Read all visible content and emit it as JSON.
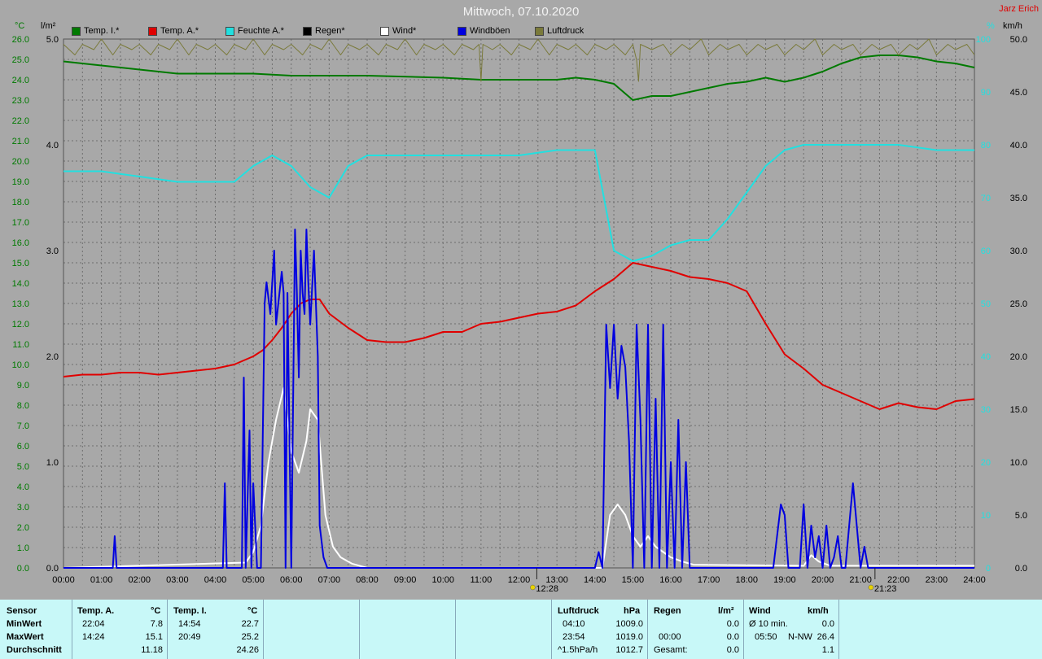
{
  "header": {
    "title": "Mittwoch, 07.10.2020",
    "author": "Jarz Erich",
    "unit_temp": "°C",
    "unit_rain": "l/m²",
    "unit_hum": "%",
    "unit_wind": "km/h"
  },
  "legend": [
    {
      "label": "Temp. I.*",
      "color": "#007a00"
    },
    {
      "label": "Temp. A.*",
      "color": "#e00000"
    },
    {
      "label": "Feuchte A.*",
      "color": "#22e0e0"
    },
    {
      "label": "Regen*",
      "color": "#000000"
    },
    {
      "label": "Wind*",
      "color": "#ffffff"
    },
    {
      "label": "Windböen",
      "color": "#0000e0"
    },
    {
      "label": "Luftdruck",
      "color": "#7a7a3a"
    }
  ],
  "chart_data": {
    "type": "line",
    "x_unit": "hours",
    "xlim": [
      0,
      24
    ],
    "x_ticks": [
      "00:00",
      "01:00",
      "02:00",
      "03:00",
      "04:00",
      "05:00",
      "06:00",
      "07:00",
      "08:00",
      "09:00",
      "10:00",
      "11:00",
      "12:00",
      "13:00",
      "14:00",
      "15:00",
      "16:00",
      "17:00",
      "18:00",
      "19:00",
      "20:00",
      "21:00",
      "22:00",
      "23:00",
      "24:00"
    ],
    "axes": {
      "temp": {
        "range": [
          0,
          26
        ],
        "ticks": [
          "0.0",
          "1.0",
          "2.0",
          "3.0",
          "4.0",
          "5.0",
          "6.0",
          "7.0",
          "8.0",
          "9.0",
          "10.0",
          "11.0",
          "12.0",
          "13.0",
          "14.0",
          "15.0",
          "16.0",
          "17.0",
          "18.0",
          "19.0",
          "20.0",
          "21.0",
          "22.0",
          "23.0",
          "24.0",
          "25.0",
          "26.0"
        ],
        "color": "#007a00"
      },
      "rain": {
        "range": [
          0,
          5
        ],
        "ticks": [
          "0.0",
          "1.0",
          "2.0",
          "3.0",
          "4.0",
          "5.0"
        ],
        "color": "#000000"
      },
      "humidity": {
        "range": [
          0,
          100
        ],
        "ticks": [
          "0",
          "10",
          "20",
          "30",
          "40",
          "50",
          "60",
          "70",
          "80",
          "90",
          "100"
        ],
        "color": "#22e0e0"
      },
      "wind": {
        "range": [
          0,
          50
        ],
        "ticks": [
          "0.0",
          "5.0",
          "10.0",
          "15.0",
          "20.0",
          "25.0",
          "30.0",
          "35.0",
          "40.0",
          "45.0",
          "50.0"
        ],
        "color": "#000000"
      }
    },
    "markers": [
      {
        "label": "12:28",
        "x": 12.47
      },
      {
        "label": "21:23",
        "x": 21.38
      }
    ],
    "series": [
      {
        "name": "Temp. I.*",
        "axis": "temp",
        "color": "#007a00",
        "x": [
          0,
          0.5,
          1,
          2,
          3,
          4,
          5,
          6,
          6.5,
          7,
          8,
          10,
          11,
          12,
          13,
          13.5,
          14,
          14.5,
          15,
          15.5,
          16,
          17,
          17.5,
          18,
          18.5,
          19,
          19.5,
          20,
          20.5,
          21,
          21.5,
          22,
          22.5,
          23,
          23.5,
          24
        ],
        "y": [
          24.9,
          24.8,
          24.7,
          24.5,
          24.3,
          24.3,
          24.3,
          24.2,
          24.2,
          24.2,
          24.2,
          24.1,
          24.0,
          24.0,
          24.0,
          24.1,
          24.0,
          23.8,
          23.0,
          23.2,
          23.2,
          23.6,
          23.8,
          23.9,
          24.1,
          23.9,
          24.1,
          24.4,
          24.8,
          25.1,
          25.2,
          25.2,
          25.1,
          24.9,
          24.8,
          24.6
        ]
      },
      {
        "name": "Temp. A.*",
        "axis": "temp",
        "color": "#e00000",
        "x": [
          0,
          0.5,
          1,
          1.5,
          2,
          2.5,
          3,
          3.5,
          4,
          4.5,
          5,
          5.25,
          5.5,
          5.75,
          6,
          6.25,
          6.5,
          6.75,
          7,
          7.5,
          8,
          8.5,
          9,
          9.5,
          10,
          10.5,
          11,
          11.5,
          12,
          12.5,
          13,
          13.5,
          14,
          14.5,
          15,
          15.5,
          16,
          16.5,
          17,
          17.5,
          18,
          18.5,
          19,
          19.5,
          20,
          20.5,
          21,
          21.5,
          22,
          22.5,
          23,
          23.5,
          24
        ],
        "y": [
          9.4,
          9.5,
          9.5,
          9.6,
          9.6,
          9.5,
          9.6,
          9.7,
          9.8,
          10.0,
          10.4,
          10.7,
          11.2,
          11.8,
          12.5,
          13.0,
          13.2,
          13.2,
          12.5,
          11.8,
          11.2,
          11.1,
          11.1,
          11.3,
          11.6,
          11.6,
          12.0,
          12.1,
          12.3,
          12.5,
          12.6,
          12.9,
          13.6,
          14.2,
          15.0,
          14.8,
          14.6,
          14.3,
          14.2,
          14.0,
          13.6,
          12.0,
          10.5,
          9.8,
          9.0,
          8.6,
          8.2,
          7.8,
          8.1,
          7.9,
          7.8,
          8.2,
          8.3
        ]
      },
      {
        "name": "Feuchte A.*",
        "axis": "humidity",
        "color": "#22e0e0",
        "x": [
          0,
          1,
          2,
          3,
          4,
          4.5,
          5,
          5.5,
          6,
          6.5,
          7,
          7.5,
          8,
          9,
          10,
          11,
          12,
          13,
          14,
          14.5,
          15,
          15.5,
          16,
          16.5,
          17,
          17.5,
          18,
          18.5,
          19,
          19.5,
          20,
          21,
          22,
          23,
          24
        ],
        "y": [
          75,
          75,
          74,
          73,
          73,
          73,
          76,
          78,
          76,
          72,
          70,
          76,
          78,
          78,
          78,
          78,
          78,
          79,
          79,
          60,
          58,
          59,
          61,
          62,
          62,
          66,
          71,
          76,
          79,
          80,
          80,
          80,
          80,
          79,
          79
        ]
      },
      {
        "name": "Wind*",
        "axis": "wind",
        "color": "#ffffff",
        "x": [
          0,
          4.8,
          5.0,
          5.2,
          5.4,
          5.6,
          5.8,
          6.0,
          6.2,
          6.4,
          6.5,
          6.7,
          6.9,
          7.1,
          7.3,
          7.6,
          8.0,
          14.2,
          14.4,
          14.6,
          14.8,
          15.0,
          15.2,
          15.4,
          15.6,
          15.8,
          16.0,
          16.3,
          16.6,
          19.5,
          19.7,
          19.9,
          20.2,
          24
        ],
        "y": [
          0,
          0.5,
          1.5,
          4.0,
          10.0,
          14.0,
          17.0,
          11.0,
          9.0,
          12.0,
          15.0,
          14.0,
          5.0,
          2.0,
          1.0,
          0.4,
          0,
          0,
          5.0,
          6.0,
          5.0,
          3.0,
          2.0,
          3.0,
          2.0,
          1.5,
          1.0,
          0.6,
          0.3,
          0.2,
          1.2,
          0.6,
          0.2,
          0.2
        ]
      },
      {
        "name": "Windböen",
        "axis": "wind",
        "color": "#0000e0",
        "x": [
          0,
          1.3,
          1.35,
          1.4,
          4.2,
          4.25,
          4.3,
          4.35,
          4.7,
          4.75,
          4.8,
          4.9,
          4.95,
          5.0,
          5.1,
          5.2,
          5.3,
          5.35,
          5.45,
          5.55,
          5.6,
          5.75,
          5.8,
          5.85,
          5.9,
          6.0,
          6.1,
          6.15,
          6.2,
          6.25,
          6.3,
          6.35,
          6.4,
          6.45,
          6.5,
          6.6,
          6.7,
          6.75,
          6.85,
          6.95,
          7.0,
          14.0,
          14.1,
          14.2,
          14.3,
          14.4,
          14.5,
          14.6,
          14.7,
          14.8,
          14.9,
          15.0,
          15.1,
          15.2,
          15.3,
          15.4,
          15.5,
          15.6,
          15.7,
          15.8,
          15.9,
          16.0,
          16.1,
          16.2,
          16.3,
          16.4,
          16.5,
          16.6,
          18.7,
          18.9,
          19.0,
          19.1,
          19.2,
          19.4,
          19.5,
          19.6,
          19.7,
          19.8,
          19.9,
          20.0,
          20.1,
          20.2,
          20.3,
          20.4,
          20.5,
          20.6,
          20.8,
          21.0,
          21.1,
          21.2,
          23.2,
          23.3,
          24
        ],
        "y": [
          0,
          0,
          3.0,
          0,
          0,
          8.0,
          0,
          0,
          0,
          18.0,
          0,
          13.0,
          0,
          8.0,
          0,
          0,
          25.0,
          27.0,
          24.0,
          30.0,
          23.0,
          28.0,
          26.0,
          0,
          26.0,
          0,
          32.0,
          26.0,
          18.0,
          30.0,
          26.0,
          24.0,
          32.0,
          27.0,
          23.0,
          30.0,
          20.0,
          4.0,
          1.0,
          0,
          0,
          0,
          1.5,
          0,
          23.0,
          17.0,
          23.0,
          16.0,
          21.0,
          19.0,
          12.0,
          0,
          23.0,
          14.0,
          0,
          23.0,
          0,
          16.0,
          0,
          23.0,
          0,
          10.0,
          0,
          14.0,
          0,
          10.0,
          0,
          0,
          0,
          6.0,
          5.0,
          0,
          0,
          0,
          6.0,
          0,
          4.0,
          1.0,
          3.0,
          0,
          4.0,
          0,
          1.0,
          3.0,
          0,
          0,
          8.0,
          0,
          2.0,
          0,
          0,
          0,
          0
        ]
      },
      {
        "name": "Luftdruck",
        "axis": "humidity",
        "color": "#7a7a3a",
        "x": [
          0,
          0.3,
          0.5,
          0.8,
          1.0,
          1.3,
          1.5,
          1.8,
          2.0,
          2.3,
          2.5,
          2.8,
          3.0,
          3.3,
          3.5,
          3.8,
          4.0,
          4.3,
          4.5,
          4.8,
          5.0,
          5.3,
          5.5,
          5.8,
          6.0,
          6.3,
          6.5,
          6.8,
          7.0,
          7.3,
          7.5,
          7.8,
          8.0,
          8.3,
          8.5,
          8.8,
          9.0,
          9.3,
          9.5,
          9.8,
          10.0,
          10.3,
          10.5,
          10.8,
          10.95,
          11.0,
          11.05,
          11.3,
          11.5,
          11.8,
          12.0,
          12.3,
          12.5,
          12.8,
          13.0,
          13.3,
          13.5,
          13.8,
          14.0,
          14.3,
          14.5,
          14.8,
          15.0,
          15.1,
          15.15,
          15.2,
          15.5,
          15.8,
          16.0,
          16.3,
          16.5,
          16.8,
          17.0,
          17.3,
          17.5,
          17.8,
          18.0,
          18.3,
          18.5,
          18.8,
          19.0,
          19.3,
          19.5,
          19.8,
          20.0,
          20.3,
          20.5,
          20.8,
          21.0,
          21.3,
          21.5,
          21.8,
          22.0,
          22.3,
          22.5,
          22.8,
          23.0,
          23.3,
          23.5,
          23.8,
          24.0
        ],
        "y": [
          99,
          97,
          99,
          98,
          100,
          97,
          99,
          98,
          99,
          97,
          99,
          98,
          100,
          97,
          99,
          98,
          99,
          97,
          99,
          98,
          100,
          97,
          99,
          98,
          99,
          97,
          99,
          98,
          100,
          97,
          99,
          98,
          99,
          97,
          99,
          98,
          100,
          97,
          99,
          98,
          99,
          97,
          99,
          98,
          99,
          92,
          99,
          98,
          99,
          97,
          99,
          98,
          100,
          97,
          99,
          98,
          99,
          97,
          99,
          98,
          99,
          97,
          99,
          96,
          92,
          99,
          98,
          99,
          97,
          99,
          98,
          100,
          97,
          99,
          98,
          99,
          97,
          99,
          98,
          99,
          97,
          99,
          98,
          100,
          97,
          99,
          98,
          99,
          97,
          99,
          98,
          99,
          97,
          99,
          98,
          100,
          97,
          99,
          98,
          99,
          97
        ]
      }
    ]
  },
  "panel": {
    "sensor": {
      "title": "Sensor",
      "rows": [
        "MinWert",
        "MaxWert",
        "Durchschnitt"
      ]
    },
    "temp_a": {
      "title": "Temp. A.",
      "unit": "°C",
      "min_time": "22:04",
      "min_val": "7.8",
      "max_time": "14:24",
      "max_val": "15.1",
      "avg": "11.18"
    },
    "temp_i": {
      "title": "Temp. I.",
      "unit": "°C",
      "min_time": "14:54",
      "min_val": "22.7",
      "max_time": "20:49",
      "max_val": "25.2",
      "avg": "24.26"
    },
    "pressure": {
      "title": "Luftdruck",
      "unit": "hPa",
      "min_time": "04:10",
      "min_val": "1009.0",
      "max_time": "23:54",
      "max_val": "1019.0",
      "trend": "^1.5hPa/h",
      "avg": "1012.7"
    },
    "rain": {
      "title": "Regen",
      "unit": "l/m²",
      "r1_val": "0.0",
      "r2_time": "00:00",
      "r2_val": "0.0",
      "total_label": "Gesamt:",
      "total": "0.0"
    },
    "wind": {
      "title": "Wind",
      "unit": "km/h",
      "avg_label": "Ø 10 min.",
      "avg_val": "0.0",
      "max_time": "05:50",
      "max_dir": "N-NW",
      "max_val": "26.4",
      "mean": "1.1"
    }
  }
}
